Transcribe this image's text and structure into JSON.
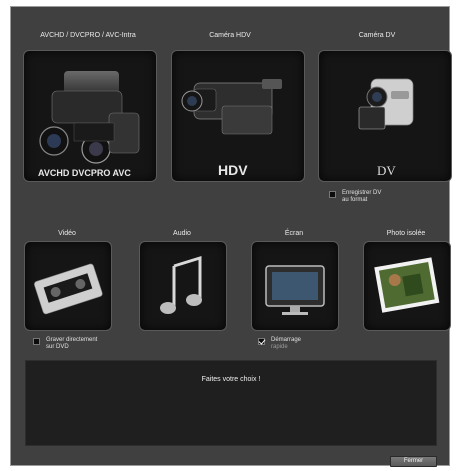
{
  "sources_top": [
    {
      "label": "AVCHD / DVCPRO / AVC-Intra",
      "icon": "avchd-camcorder-icon",
      "logo_text": "AVCHD DVCPRO AVC"
    },
    {
      "label": "Caméra HDV",
      "icon": "hdv-camera-icon",
      "logo_text": "HDV"
    },
    {
      "label": "Caméra DV",
      "icon": "dv-camera-icon",
      "logo_text": "DV"
    }
  ],
  "dv_option": {
    "line1": "Enregistrer DV",
    "line2": "au format",
    "checked": false
  },
  "sources_bottom": [
    {
      "label": "Vidéo",
      "icon": "vhs-tape-icon"
    },
    {
      "label": "Audio",
      "icon": "music-note-icon"
    },
    {
      "label": "Écran",
      "icon": "monitor-icon"
    },
    {
      "label": "Photo isolée",
      "icon": "photo-icon"
    }
  ],
  "dvd_option": {
    "line1": "Graver directement",
    "line2": "sur DVD",
    "checked": false
  },
  "startup_option": {
    "line1": "Démarrage",
    "line2": "rapide",
    "checked": true
  },
  "message": "Faites votre choix !",
  "close_button": "Fermer"
}
